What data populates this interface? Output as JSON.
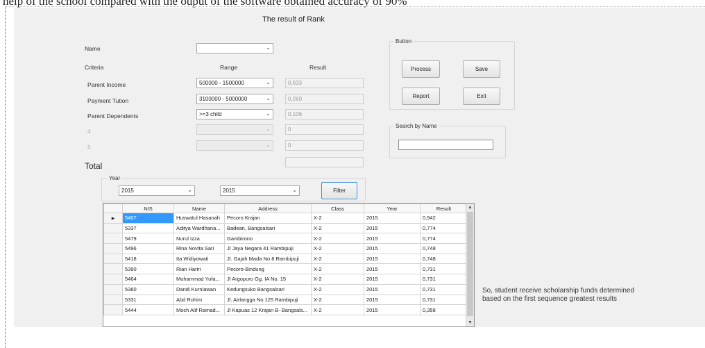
{
  "document": {
    "top_text": "help of the school compared with the ouput of the software obtained accuracy of 90%",
    "caption_line1": "So, student receive scholarship funds determined",
    "caption_line2": "based on the first sequence greatest results"
  },
  "form": {
    "title": "The result of Rank",
    "name_label": "Name",
    "name_value": "",
    "criteria_label": "Criteria",
    "range_header": "Range",
    "result_header": "Result",
    "criteria": [
      {
        "label": "Parent Income",
        "range": "500000 - 1500000",
        "result": "0,633",
        "enabled": true
      },
      {
        "label": "Payment Tution",
        "range": "3100000 - 5000000",
        "result": "0,260",
        "enabled": true
      },
      {
        "label": "Parent Dependents",
        "range": ">=3 child",
        "result": "0,106",
        "enabled": true
      },
      {
        "label": "4",
        "range": "",
        "result": "0",
        "enabled": false
      },
      {
        "label": "5",
        "range": "",
        "result": "0",
        "enabled": false
      }
    ],
    "total_label": "Total",
    "total_value": "",
    "button_group_title": "Button",
    "buttons": {
      "process": "Process",
      "save": "Save",
      "report": "Report",
      "exit": "Exit"
    },
    "search_group_title": "Search by Name",
    "search_value": "",
    "year_group_title": "Year",
    "year_from": "2015",
    "year_to": "2015",
    "filter_button": "Filter",
    "dropdown_arrow": "chevron-down-icon",
    "row_indicator": "row-pointer-icon"
  },
  "grid": {
    "columns": [
      "NIS",
      "Name",
      "Address",
      "Class",
      "Year",
      "Result"
    ],
    "rows": [
      {
        "nis": "5407",
        "name": "Huswatul Hasanah",
        "address": "Pecoro Krajan",
        "class": "X-2",
        "year": "2015",
        "result": "0,942",
        "selected": true
      },
      {
        "nis": "5337",
        "name": "Aditya Wardhana...",
        "address": "Badean, Bangsalsari",
        "class": "X-2",
        "year": "2015",
        "result": "0,774"
      },
      {
        "nis": "5479",
        "name": "Nurul Izza",
        "address": "Gambirono",
        "class": "X-2",
        "year": "2015",
        "result": "0,774"
      },
      {
        "nis": "5496",
        "name": "Rina Novita Sari",
        "address": "Jl Jaya Negara 41 Rambipuji",
        "class": "X-2",
        "year": "2015",
        "result": "0,748"
      },
      {
        "nis": "5418",
        "name": "Ita Widiyowati",
        "address": "Jl. Gajah Mada No 8 Rambipuji",
        "class": "X-2",
        "year": "2015",
        "result": "0,748"
      },
      {
        "nis": "5390",
        "name": "Rian Hariri",
        "address": "Pecoro-Bindung",
        "class": "X-2",
        "year": "2015",
        "result": "0,731"
      },
      {
        "nis": "5464",
        "name": "Muhammad Yufa...",
        "address": "Jl Argopuro Gg. IA No. 15",
        "class": "X-2",
        "year": "2015",
        "result": "0,731"
      },
      {
        "nis": "5360",
        "name": "Dandi Kurniawan",
        "address": "Kedungsuko Bangsalsari",
        "class": "X-2",
        "year": "2015",
        "result": "0,731"
      },
      {
        "nis": "5331",
        "name": "Abd Rohim",
        "address": "Jl. Airlangga No 125 Rambipuji",
        "class": "X-2",
        "year": "2015",
        "result": "0,731"
      },
      {
        "nis": "5444",
        "name": "Moch Alif Ramad...",
        "address": "Jl Kapuas 12 Krajan B- Bangsals...",
        "class": "X-2",
        "year": "2015",
        "result": "0,358"
      }
    ]
  }
}
